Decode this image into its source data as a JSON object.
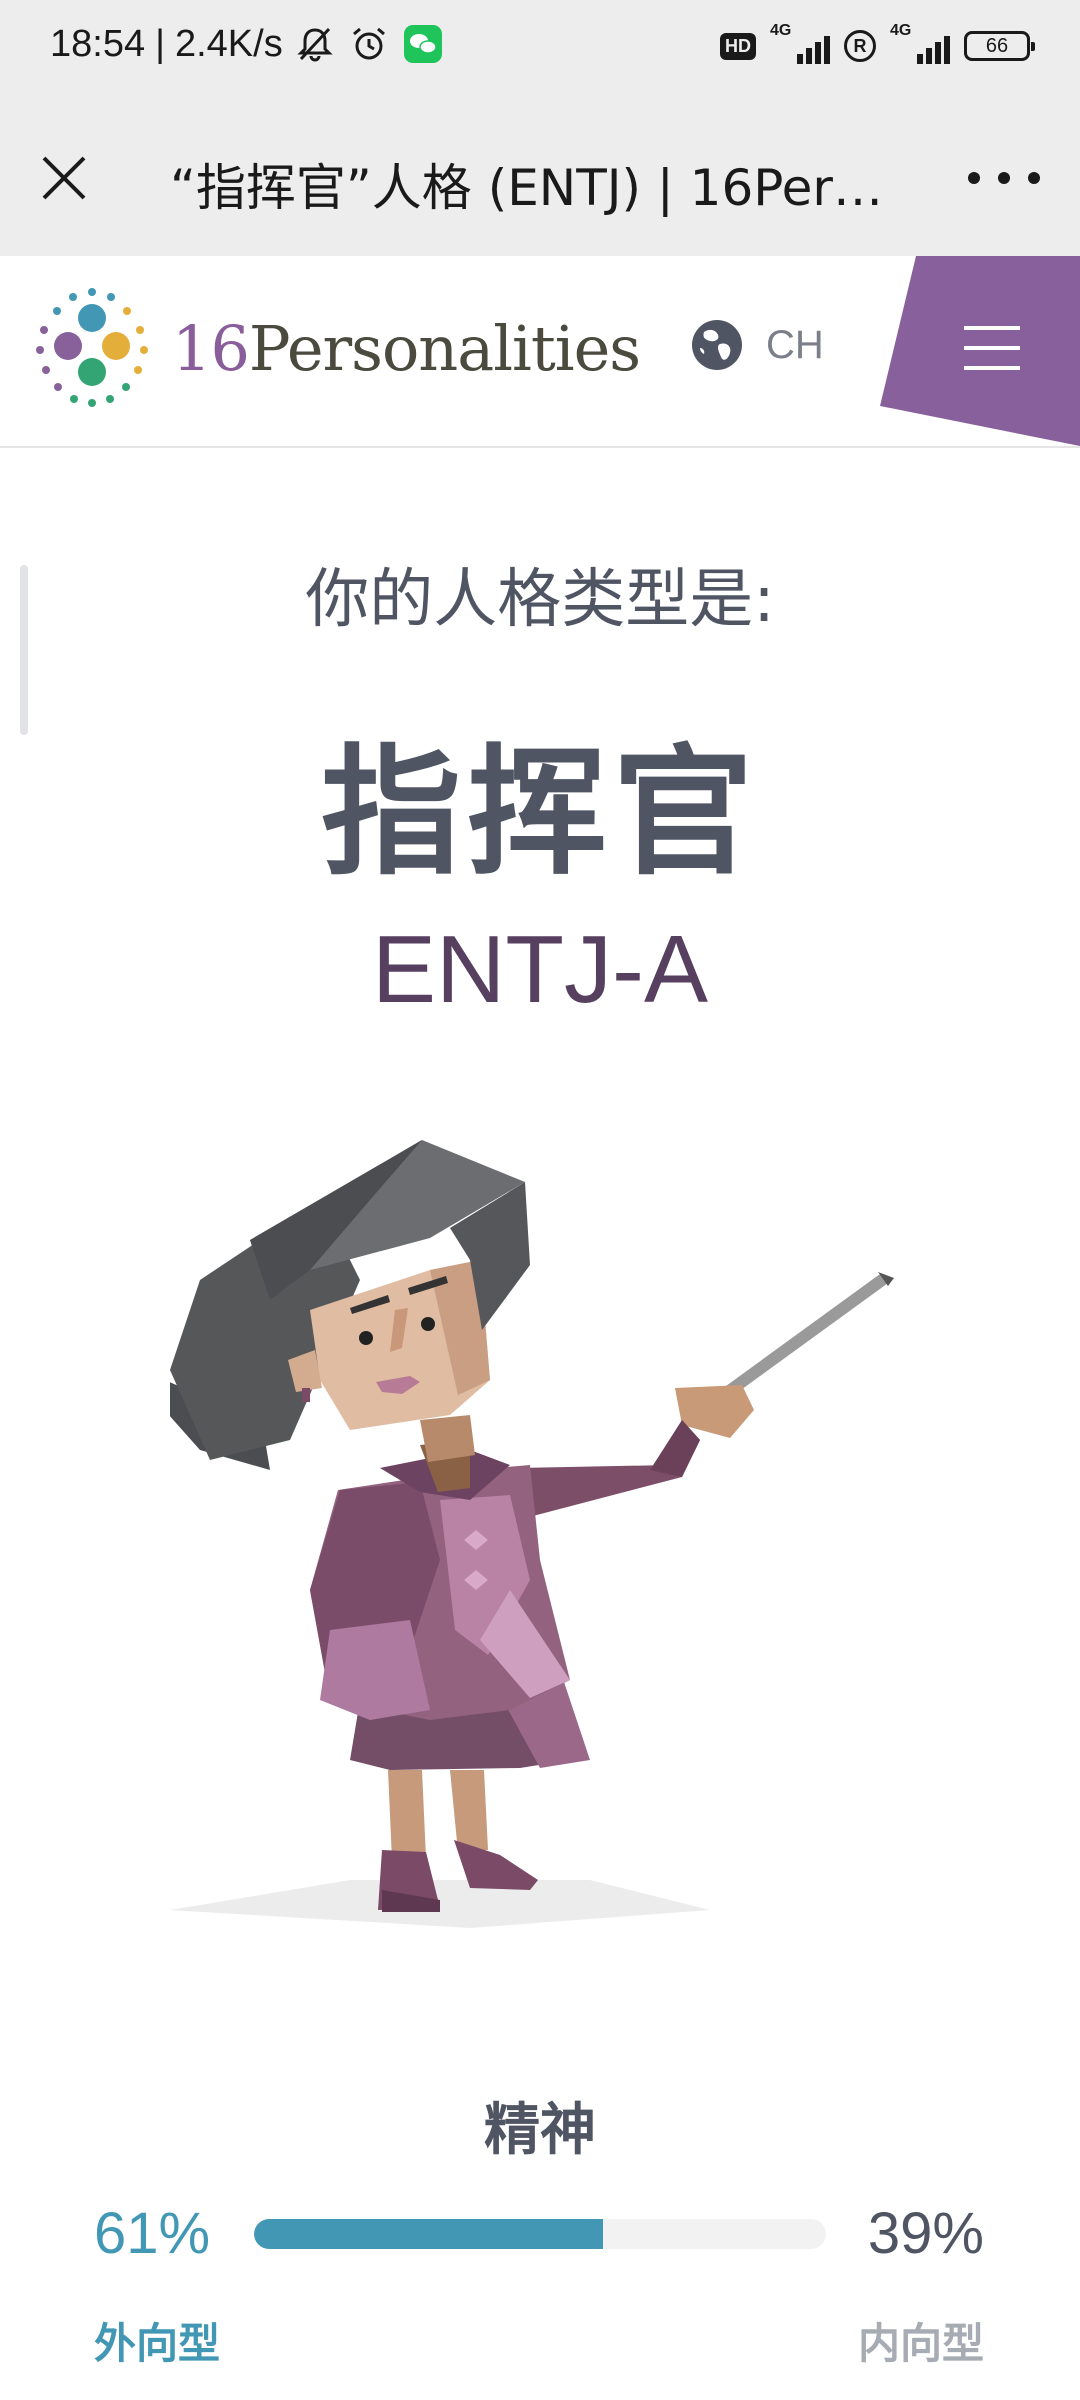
{
  "status_bar": {
    "time": "18:54",
    "speed": "2.4K/s",
    "hd": "HD",
    "network_1": "4G",
    "network_2": "4G",
    "registered": "R",
    "battery": "66",
    "icons": [
      "mute-icon",
      "alarm-icon",
      "wechat-icon",
      "signal-icon",
      "battery-icon"
    ]
  },
  "web_header": {
    "title": "“指挥官”人格 (ENTJ) | 16Personalities",
    "close_icon": "close-icon",
    "more_icon": "more-icon"
  },
  "site_nav": {
    "logo_number": "16",
    "logo_word": "Personalities",
    "language": "CH",
    "globe_icon": "globe-icon",
    "menu_icon": "hamburger-menu-icon",
    "accent_color": "#87609c"
  },
  "result": {
    "intro": "你的人格类型是:",
    "type_name": "指挥官",
    "type_code": "ENTJ-A"
  },
  "trait": {
    "title": "精神",
    "left_percent": "61%",
    "right_percent": "39%",
    "left_value": 61,
    "left_label": "外向型",
    "right_label": "内向型",
    "bar_color": "#4298b4"
  }
}
